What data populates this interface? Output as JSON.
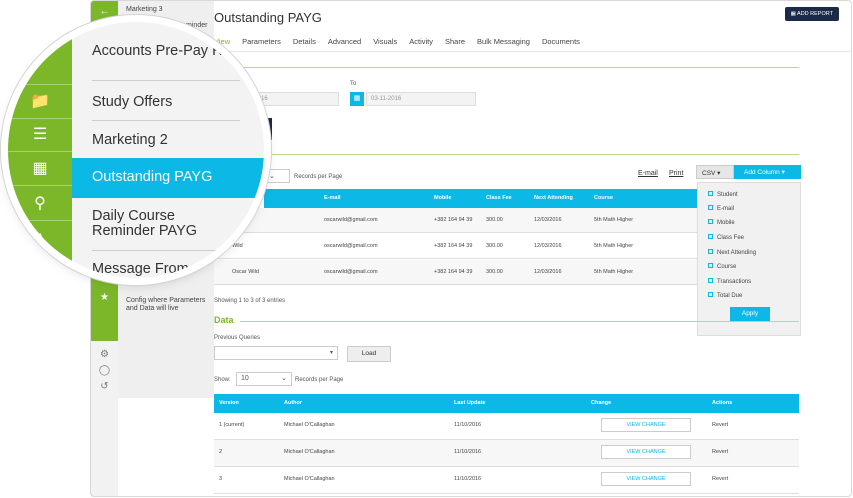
{
  "subnav": {
    "items": [
      "Marketing 3",
      "Accounts PAYG Reminder",
      "Config where Parameters and Data will live"
    ]
  },
  "page": {
    "title": "Outstanding PAYG",
    "add_report": "ADD REPORT"
  },
  "tabs": [
    "View",
    "Parameters",
    "Details",
    "Advanced",
    "Visuals",
    "Activity",
    "Share",
    "Bulk Messaging",
    "Documents"
  ],
  "view": {
    "section_title": "View",
    "to_label": "To",
    "from_value": "1-2016",
    "to_value": "03-11-2016"
  },
  "results": {
    "records_per_page": "Records per Page",
    "email_link": "E-mail",
    "print_link": "Print",
    "csv": "CSV",
    "add_column": "Add Column",
    "headers": [
      "E-mail",
      "Mobile",
      "Class Fee",
      "Next Attending",
      "Course"
    ],
    "rows": [
      {
        "name": "",
        "email": "oscarwild@gmail.com",
        "mobile": "+382 164 94 39",
        "fee": "300.00",
        "next": "12/03/2016",
        "course": "5th Math Higher"
      },
      {
        "name": "Wild",
        "email": "oscarwild@gmail.com",
        "mobile": "+382 164 94 39",
        "fee": "300.00",
        "next": "12/03/2016",
        "course": "5th Math Higher"
      },
      {
        "name": "Oscar Wild",
        "email": "oscarwild@gmail.com",
        "mobile": "+382 164 94 39",
        "fee": "300.00",
        "next": "12/03/2016",
        "course": "5th Math Higher"
      }
    ],
    "showing": "Showing 1 to 3 of 3 entries",
    "column_options": [
      "Student",
      "E-mail",
      "Mobile",
      "Class Fee",
      "Next Attending",
      "Course",
      "Transactions",
      "Total Due"
    ],
    "apply": "Apply"
  },
  "data": {
    "section_title": "Data",
    "previous_queries": "Previous Queries",
    "load": "Load",
    "show": "Show:",
    "show_value": "10",
    "records_per_page": "Records per Page",
    "headers": [
      "Version",
      "Author",
      "Last Update",
      "Change",
      "Actions"
    ],
    "rows": [
      {
        "version": "1 (current)",
        "author": "Michael O'Callaghan",
        "updated": "11/10/2016",
        "change": "VIEW CHANGE",
        "action": "Revert"
      },
      {
        "version": "2",
        "author": "Michael O'Callaghan",
        "updated": "11/10/2016",
        "change": "VIEW CHANGE",
        "action": "Revert"
      },
      {
        "version": "3",
        "author": "Michael O'Callaghan",
        "updated": "11/10/2016",
        "change": "VIEW CHANGE",
        "action": "Revert"
      }
    ]
  },
  "magnifier": {
    "items": [
      "Accounts Pre-Pay Reminder",
      "Study Offers",
      "Marketing 2",
      "Outstanding PAYG",
      "Daily Course Reminder PAYG",
      "Message From"
    ],
    "icons": [
      "folder-icon",
      "list-icon",
      "id-card-icon",
      "map-pin-icon",
      "graduation-icon"
    ]
  },
  "colors": {
    "brand_green": "#7cb72a",
    "accent_blue": "#0bb8e6",
    "navy": "#1c2a4a"
  }
}
